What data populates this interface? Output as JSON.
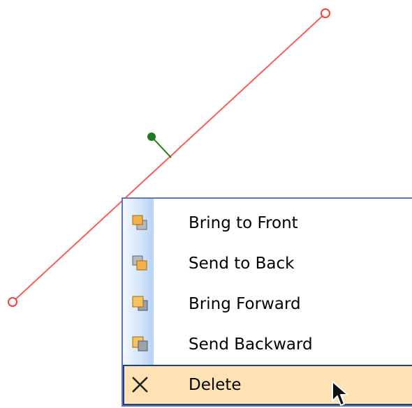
{
  "colors": {
    "line": "#ff5a5a",
    "rotation_handle": "#1f7a1f",
    "menu_border": "#5b79b5",
    "hover_fill": "#fde3b4",
    "hover_border": "#1f3d8a"
  },
  "canvas": {
    "endpoint_handles": [
      "endpoint-handle-top",
      "endpoint-handle-bottom"
    ],
    "rotation_handle": "rotation-handle"
  },
  "context_menu": {
    "items": [
      {
        "label": "Bring to Front",
        "icon": "bring-to-front-icon"
      },
      {
        "label": "Send to Back",
        "icon": "send-to-back-icon"
      },
      {
        "label": "Bring Forward",
        "icon": "bring-forward-icon"
      },
      {
        "label": "Send Backward",
        "icon": "send-backward-icon"
      },
      {
        "label": "Delete",
        "icon": "delete-icon",
        "highlighted": true
      }
    ]
  }
}
